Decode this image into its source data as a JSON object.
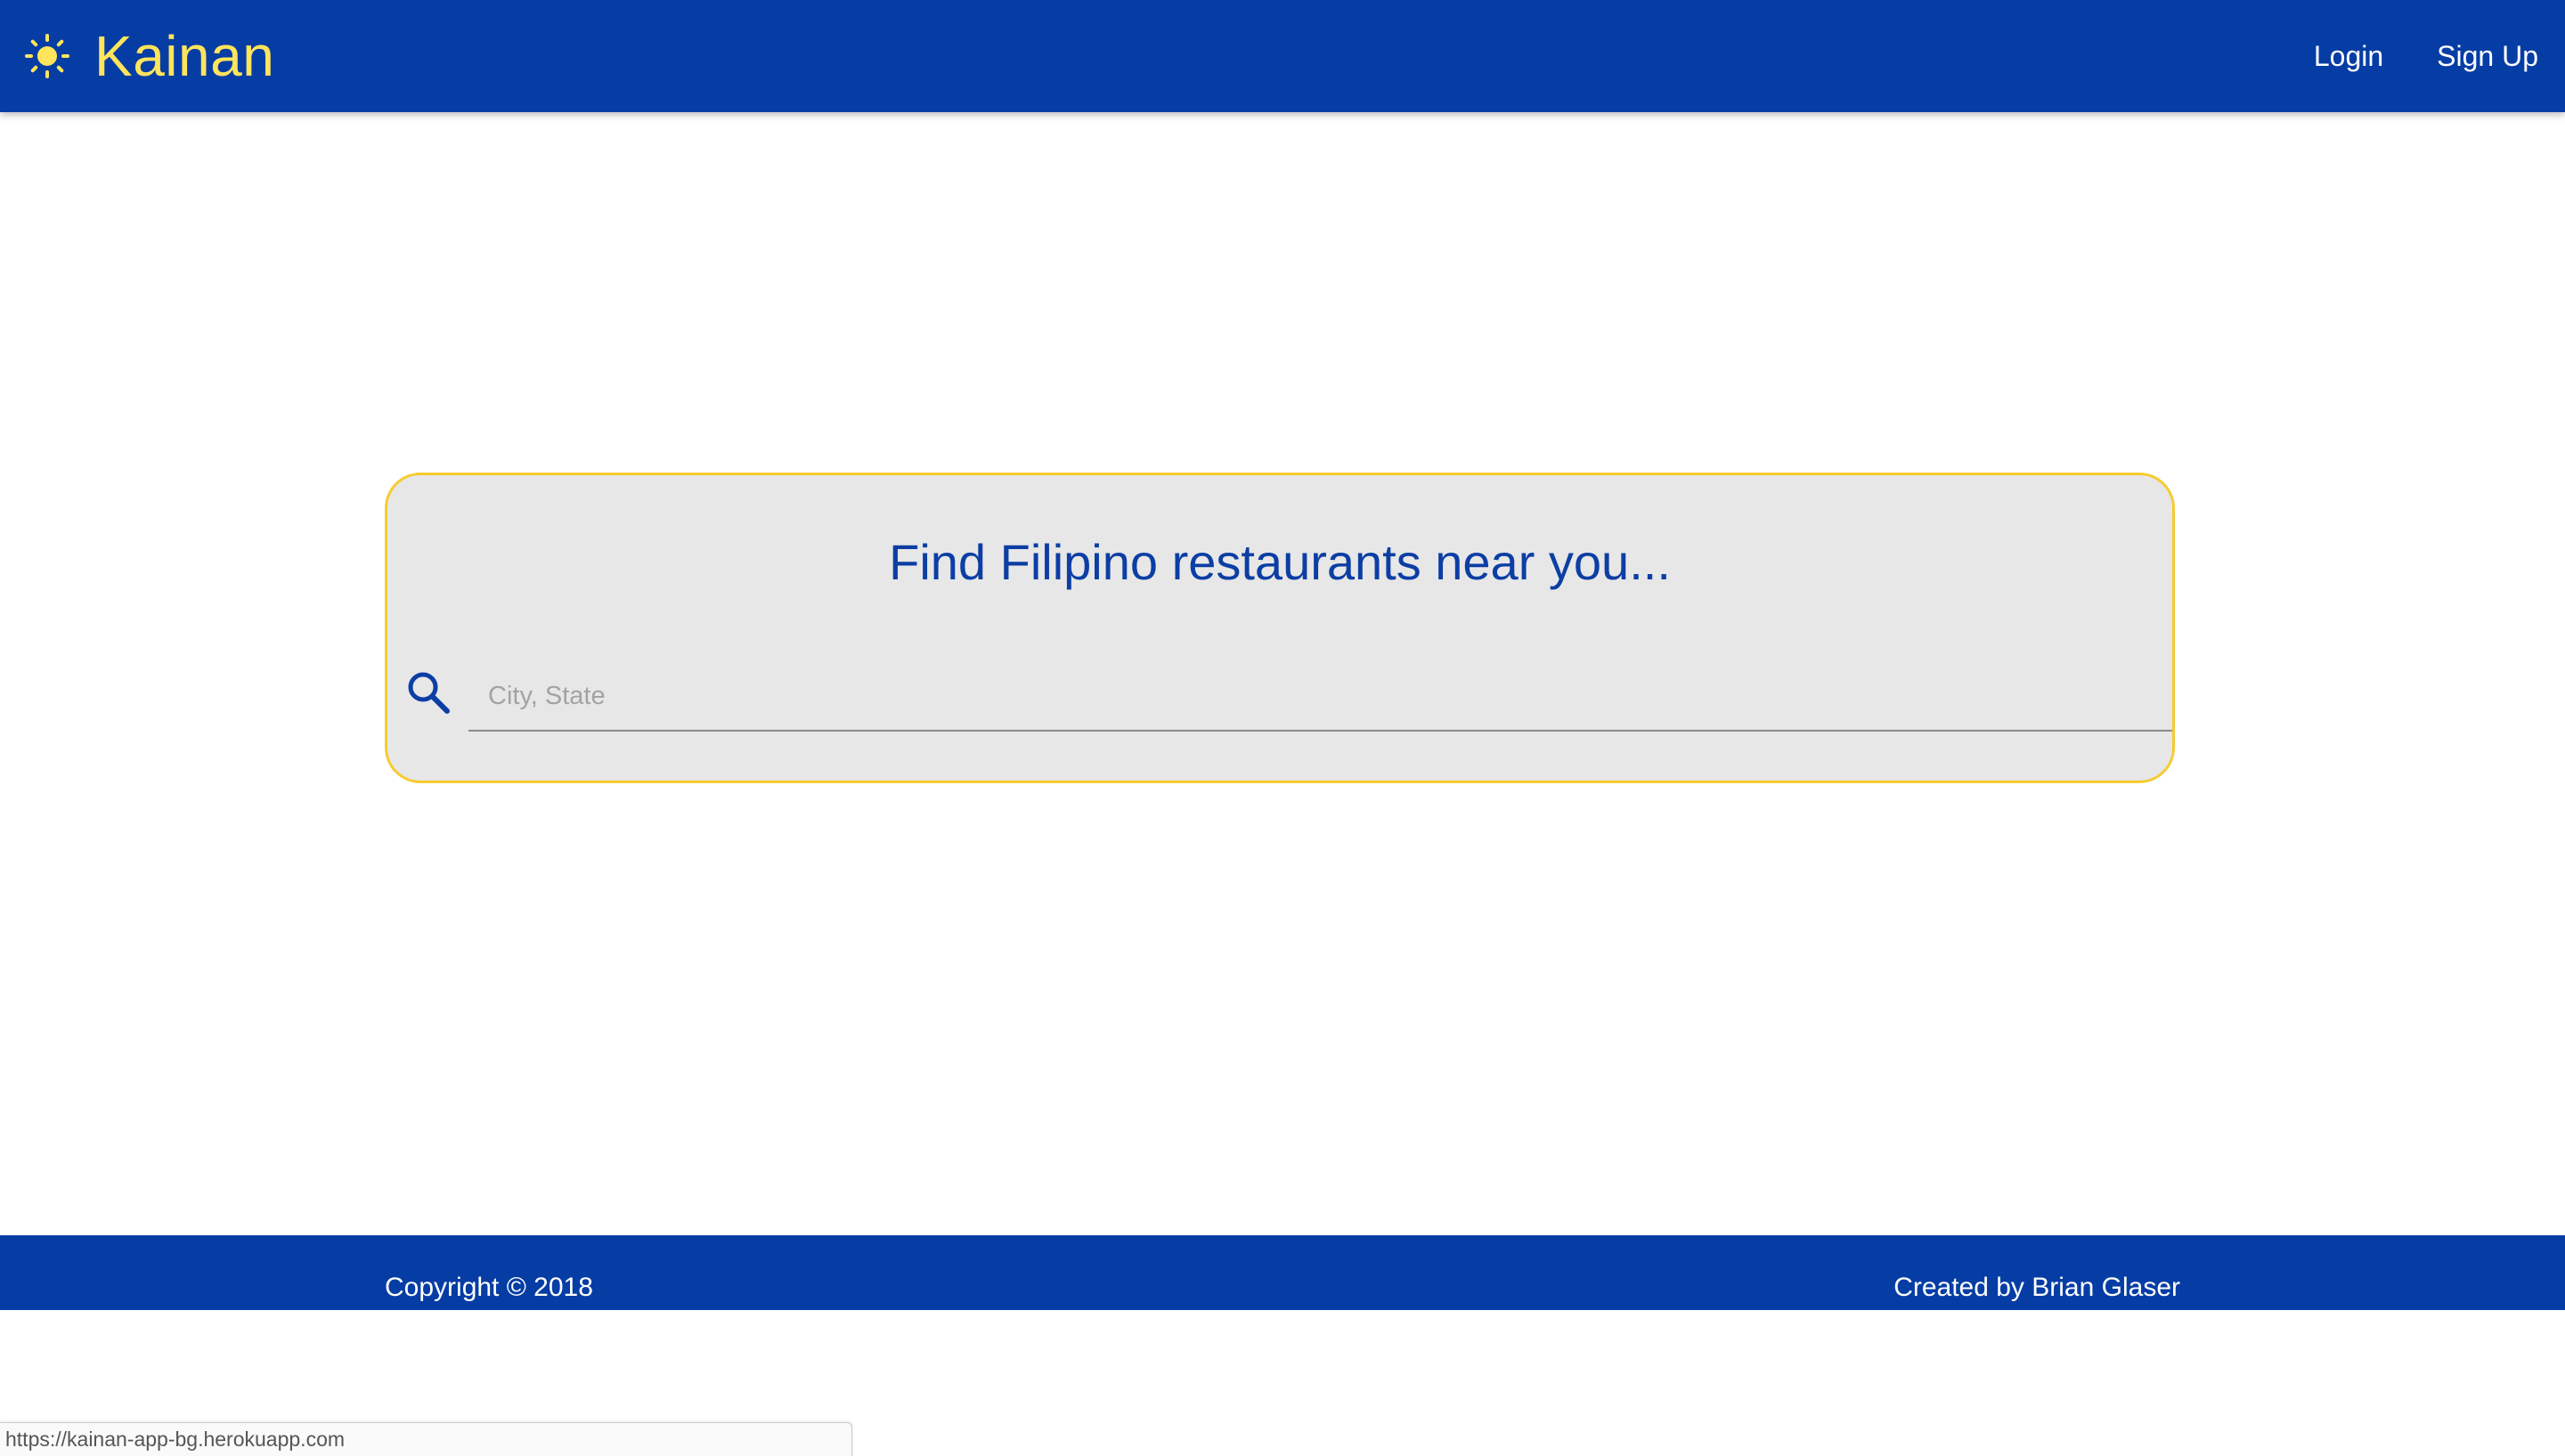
{
  "header": {
    "brand_icon": "sun-icon",
    "brand_name": "Kainan",
    "nav": {
      "login_label": "Login",
      "signup_label": "Sign Up"
    }
  },
  "search": {
    "title": "Find Filipino restaurants near you...",
    "icon": "search-icon",
    "input_value": "",
    "placeholder": "City, State"
  },
  "footer": {
    "copyright": "Copyright © 2018",
    "credit": "Created by Brian Glaser"
  },
  "status_bar": {
    "url": "https://kainan-app-bg.herokuapp.com"
  },
  "colors": {
    "primary_blue": "#063da5",
    "brand_yellow": "#ffe45c",
    "card_border": "#f6cb2f",
    "card_background": "#e7e7e7",
    "title_blue": "#0c3ea4"
  }
}
